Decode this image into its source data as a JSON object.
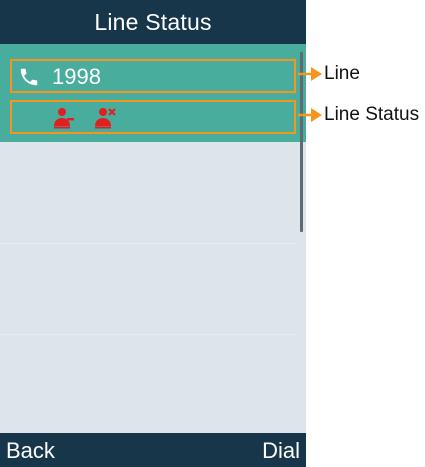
{
  "screen": {
    "title": "Line Status"
  },
  "line": {
    "icon": "phone-icon",
    "number": "1998"
  },
  "line_status": {
    "icons": [
      "registered-user-icon",
      "unregistered-user-icon"
    ]
  },
  "softkeys": {
    "left": "Back",
    "right": "Dial"
  },
  "callouts": {
    "line": "Line",
    "line_status": "Line Status"
  },
  "colors": {
    "title_bar": "#18364a",
    "highlight": "#48ad9d",
    "list_background": "#dde4ea",
    "callout_outline": "#f7941e",
    "status_icon": "#e02020"
  }
}
